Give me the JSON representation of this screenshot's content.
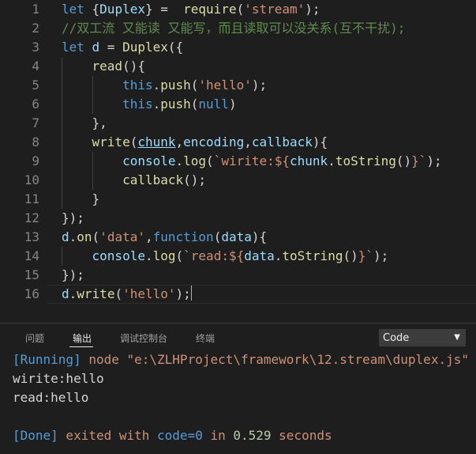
{
  "editor": {
    "line_numbers": [
      "1",
      "2",
      "3",
      "4",
      "5",
      "6",
      "7",
      "8",
      "9",
      "10",
      "11",
      "12",
      "13",
      "14",
      "15",
      "16"
    ],
    "lines": [
      [
        {
          "t": "let ",
          "c": "kw"
        },
        {
          "t": "{",
          "c": ""
        },
        {
          "t": "Duplex",
          "c": "vr"
        },
        {
          "t": "} =  ",
          "c": ""
        },
        {
          "t": "require",
          "c": "fn"
        },
        {
          "t": "(",
          "c": ""
        },
        {
          "t": "'stream'",
          "c": "str"
        },
        {
          "t": ");",
          "c": ""
        }
      ],
      [
        {
          "t": "//双工流 又能读 又能写，而且读取可以没关系(互不干扰);",
          "c": "cm"
        }
      ],
      [
        {
          "t": "let ",
          "c": "kw"
        },
        {
          "t": "d",
          "c": "vr"
        },
        {
          "t": " = ",
          "c": ""
        },
        {
          "t": "Duplex",
          "c": "fn"
        },
        {
          "t": "({",
          "c": ""
        }
      ],
      [
        {
          "t": "    ",
          "c": ""
        },
        {
          "t": "read",
          "c": "fn"
        },
        {
          "t": "(){",
          "c": ""
        }
      ],
      [
        {
          "t": "        ",
          "c": ""
        },
        {
          "t": "this",
          "c": "kw"
        },
        {
          "t": ".",
          "c": ""
        },
        {
          "t": "push",
          "c": "fn"
        },
        {
          "t": "(",
          "c": ""
        },
        {
          "t": "'hello'",
          "c": "str"
        },
        {
          "t": ");",
          "c": ""
        }
      ],
      [
        {
          "t": "        ",
          "c": ""
        },
        {
          "t": "this",
          "c": "kw"
        },
        {
          "t": ".",
          "c": ""
        },
        {
          "t": "push",
          "c": "fn"
        },
        {
          "t": "(",
          "c": ""
        },
        {
          "t": "null",
          "c": "kw"
        },
        {
          "t": ")",
          "c": ""
        }
      ],
      [
        {
          "t": "    },",
          "c": ""
        }
      ],
      [
        {
          "t": "    ",
          "c": ""
        },
        {
          "t": "write",
          "c": "fn"
        },
        {
          "t": "(",
          "c": ""
        },
        {
          "t": "chunk",
          "c": "vr ul"
        },
        {
          "t": ",",
          "c": ""
        },
        {
          "t": "encoding",
          "c": "vr"
        },
        {
          "t": ",",
          "c": ""
        },
        {
          "t": "callback",
          "c": "vr"
        },
        {
          "t": "){",
          "c": ""
        }
      ],
      [
        {
          "t": "        ",
          "c": ""
        },
        {
          "t": "console",
          "c": "vr"
        },
        {
          "t": ".",
          "c": ""
        },
        {
          "t": "log",
          "c": "fn"
        },
        {
          "t": "(",
          "c": ""
        },
        {
          "t": "`wirite:${",
          "c": "str"
        },
        {
          "t": "chunk",
          "c": "vr"
        },
        {
          "t": ".",
          "c": ""
        },
        {
          "t": "toString",
          "c": "fn"
        },
        {
          "t": "()",
          "c": ""
        },
        {
          "t": "}`",
          "c": "str"
        },
        {
          "t": ");",
          "c": ""
        }
      ],
      [
        {
          "t": "        ",
          "c": ""
        },
        {
          "t": "callback",
          "c": "fn"
        },
        {
          "t": "();",
          "c": ""
        }
      ],
      [
        {
          "t": "    }",
          "c": ""
        }
      ],
      [
        {
          "t": "});",
          "c": ""
        }
      ],
      [
        {
          "t": "d",
          "c": "vr"
        },
        {
          "t": ".",
          "c": ""
        },
        {
          "t": "on",
          "c": "fn"
        },
        {
          "t": "(",
          "c": ""
        },
        {
          "t": "'data'",
          "c": "str"
        },
        {
          "t": ",",
          "c": ""
        },
        {
          "t": "function",
          "c": "kw"
        },
        {
          "t": "(",
          "c": ""
        },
        {
          "t": "data",
          "c": "vr"
        },
        {
          "t": "){",
          "c": ""
        }
      ],
      [
        {
          "t": "    ",
          "c": ""
        },
        {
          "t": "console",
          "c": "vr"
        },
        {
          "t": ".",
          "c": ""
        },
        {
          "t": "log",
          "c": "fn"
        },
        {
          "t": "(",
          "c": ""
        },
        {
          "t": "`read:${",
          "c": "str"
        },
        {
          "t": "data",
          "c": "vr"
        },
        {
          "t": ".",
          "c": ""
        },
        {
          "t": "toString",
          "c": "fn"
        },
        {
          "t": "()",
          "c": ""
        },
        {
          "t": "}`",
          "c": "str"
        },
        {
          "t": ");",
          "c": ""
        }
      ],
      [
        {
          "t": "});",
          "c": ""
        }
      ],
      [
        {
          "t": "d",
          "c": "vr"
        },
        {
          "t": ".",
          "c": ""
        },
        {
          "t": "write",
          "c": "fn"
        },
        {
          "t": "(",
          "c": ""
        },
        {
          "t": "'hello'",
          "c": "str"
        },
        {
          "t": ");",
          "c": ""
        }
      ]
    ]
  },
  "panel": {
    "tabs": [
      "问题",
      "输出",
      "调试控制台",
      "终端"
    ],
    "active_tab": "输出",
    "output_channel": "Code",
    "output": {
      "running_tag": "[Running]",
      "command": " node \"e:\\ZLHProject\\framework\\12.stream\\duplex.js\"",
      "line1": "wirite:hello",
      "line2": "read:hello",
      "done_tag": "[Done]",
      "done_text": " exited with ",
      "code_label": "code=0",
      "in_text": " in ",
      "seconds_value": "0.529",
      "seconds_label": " seconds"
    }
  },
  "colors": {
    "background": "#1e1e1e",
    "keyword": "#569cd6",
    "string": "#ce9178",
    "comment": "#608b4e",
    "function": "#dcdcaa",
    "variable": "#9cdcfe"
  }
}
